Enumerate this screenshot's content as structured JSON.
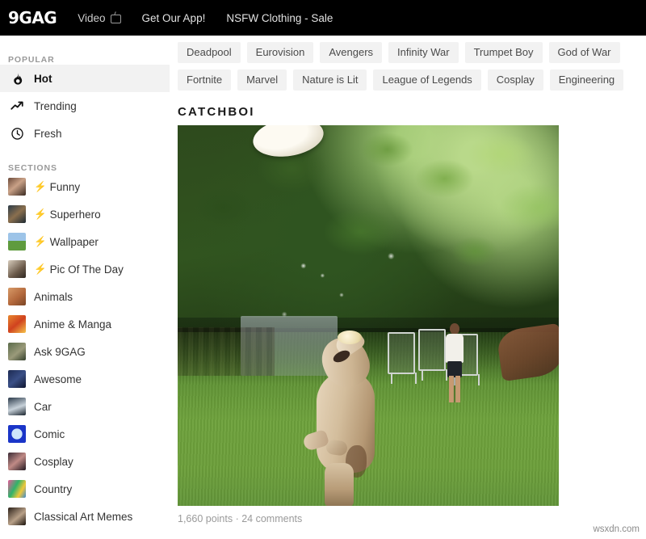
{
  "header": {
    "logo": "9GAG",
    "nav": [
      {
        "label": "Video",
        "icon": "tv-icon"
      },
      {
        "label": "Get Our App!",
        "icon": ""
      },
      {
        "label": "NSFW Clothing - Sale",
        "icon": ""
      }
    ]
  },
  "sidebar": {
    "popular_label": "POPULAR",
    "popular": [
      {
        "label": "Hot",
        "icon": "flame-icon",
        "active": true
      },
      {
        "label": "Trending",
        "icon": "trending-up-icon",
        "active": false
      },
      {
        "label": "Fresh",
        "icon": "clock-icon",
        "active": false
      }
    ],
    "sections_label": "SECTIONS",
    "sections": [
      {
        "label": "Funny",
        "bolt": "⚡",
        "thumb": "linear-gradient(140deg,#6b4a3a,#c9a187 45%,#3a2a22)"
      },
      {
        "label": "Superhero",
        "bolt": "⚡",
        "thumb": "linear-gradient(140deg,#2b3b48,#8a6f4e 50%,#1d2a33)"
      },
      {
        "label": "Wallpaper",
        "bolt": "⚡",
        "thumb": "linear-gradient(180deg,#9dc4e8 0 45%,#5f9b3e 45% 100%)"
      },
      {
        "label": "Pic Of The Day",
        "bolt": "⚡",
        "thumb": "linear-gradient(140deg,#d8cdbd,#6b5a4a 60%,#2f2822)"
      },
      {
        "label": "Animals",
        "bolt": "",
        "thumb": "linear-gradient(140deg,#d79a68,#b3683c 55%,#7a4526)"
      },
      {
        "label": "Anime & Manga",
        "bolt": "",
        "thumb": "linear-gradient(140deg,#e8872e,#d0421f 50%,#f6c34a)"
      },
      {
        "label": "Ask 9GAG",
        "bolt": "",
        "thumb": "linear-gradient(140deg,#5a6b4a,#9a9a7a 55%,#34402c)"
      },
      {
        "label": "Awesome",
        "bolt": "",
        "thumb": "linear-gradient(140deg,#1c2a52,#3a4f86 50%,#0f1630)"
      },
      {
        "label": "Car",
        "bolt": "",
        "thumb": "linear-gradient(160deg,#2b3a4a,#c8d2da 55%,#1a242e)"
      },
      {
        "label": "Comic",
        "bolt": "",
        "thumb": "radial-gradient(circle at 50% 50%,#cfe6fb 0 42%,#1a35c8 44%)"
      },
      {
        "label": "Cosplay",
        "bolt": "",
        "thumb": "linear-gradient(140deg,#3a2a34,#c08a86 50%,#221820)"
      },
      {
        "label": "Country",
        "bolt": "",
        "thumb": "linear-gradient(120deg,#e85a9a,#2fb36a 40%,#f0c83a 70%,#3a8ad0)"
      },
      {
        "label": "Classical Art Memes",
        "bolt": "",
        "thumb": "linear-gradient(140deg,#2b2018,#b8a088 55%,#1a120c)"
      }
    ]
  },
  "main": {
    "tags": [
      "Deadpool",
      "Eurovision",
      "Avengers",
      "Infinity War",
      "Trumpet Boy",
      "God of War",
      "Fortnite",
      "Marvel",
      "Nature is Lit",
      "League of Legends",
      "Cosplay",
      "Engineering"
    ],
    "post": {
      "title": "CATCHBOI",
      "meta": "1,660 points · 24 comments"
    }
  },
  "watermark": "wsxdn.com",
  "colors": {
    "header_bg": "#000000",
    "tag_bg": "#f2f2f2",
    "active_row_bg": "#f2f2f2",
    "text_primary": "#333333",
    "text_muted": "#9a9a9a"
  }
}
